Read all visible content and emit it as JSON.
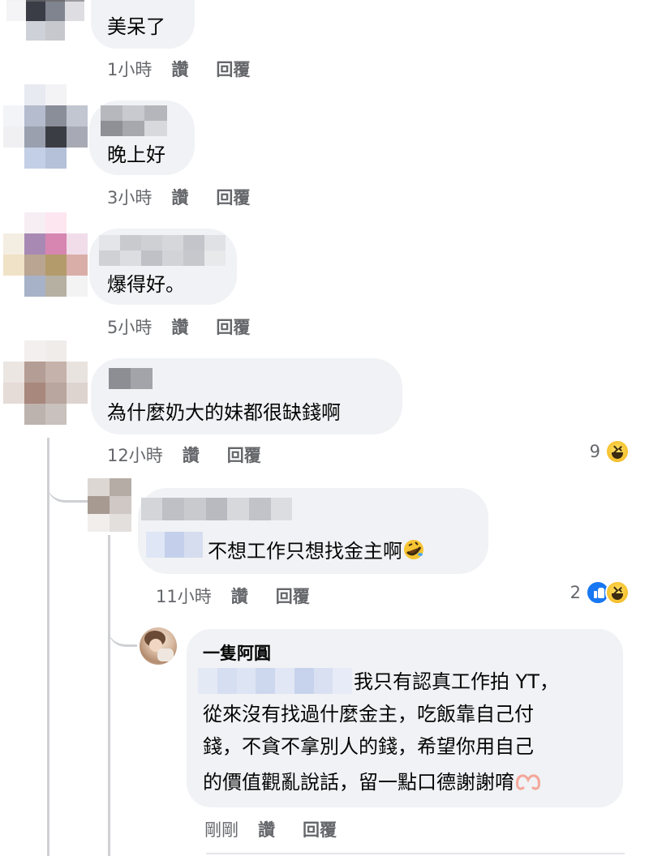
{
  "comments": [
    {
      "id": "c1",
      "text": "美呆了",
      "time": "1小時",
      "like_label": "讚",
      "reply_label": "回覆"
    },
    {
      "id": "c2",
      "text": "晚上好",
      "time": "3小時",
      "like_label": "讚",
      "reply_label": "回覆"
    },
    {
      "id": "c3",
      "text": "爆得好。",
      "time": "5小時",
      "like_label": "讚",
      "reply_label": "回覆"
    },
    {
      "id": "c4",
      "text": "為什麼奶大的妹都很缺錢啊",
      "time": "12小時",
      "like_label": "讚",
      "reply_label": "回覆",
      "reaction_count": "9",
      "reaction_icons": [
        "haha-icon"
      ]
    }
  ],
  "reply1": {
    "text": "不想工作只想找金主啊",
    "trailing_emoji": "rolling-on-floor-laughing-icon",
    "time": "11小時",
    "like_label": "讚",
    "reply_label": "回覆",
    "reaction_count": "2",
    "reaction_icons": [
      "like-icon",
      "haha-icon"
    ]
  },
  "reply2": {
    "author": "一隻阿圓",
    "line1": "我只有認真工作拍 YT，",
    "line2": "從來沒有找過什麼金主，吃飯靠自己付",
    "line3": "錢，不貪不拿別人的錢，希望你用自己",
    "line4": "的價值觀亂說話，留一點口德謝謝唷",
    "trailing_emoji": "heart-hands-icon",
    "time": "剛剛",
    "like_label": "讚",
    "reply_label": "回覆"
  },
  "colors": {
    "bubble": "#f0f2f5",
    "meta_text": "#65676b",
    "thread_line": "#ced0d4",
    "like_blue": "#1877f2"
  }
}
